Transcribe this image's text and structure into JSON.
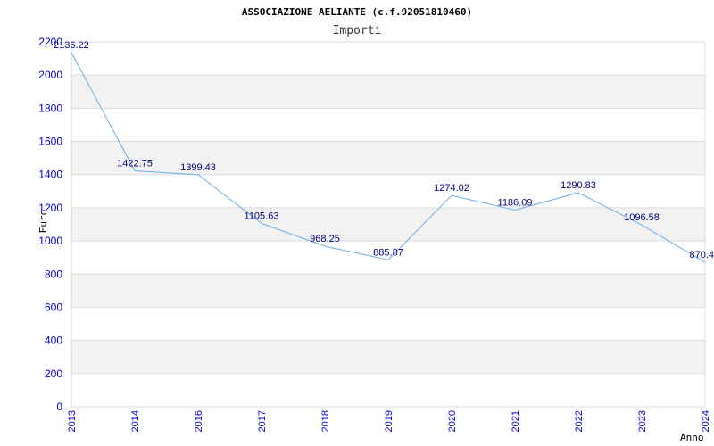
{
  "chart_data": {
    "type": "line",
    "title": "ASSOCIAZIONE AELIANTE (c.f.92051810460)",
    "subtitle": "Importi",
    "xlabel": "Anno",
    "ylabel": "Euro",
    "categories": [
      "2013",
      "2014",
      "2016",
      "2017",
      "2018",
      "2019",
      "2020",
      "2021",
      "2022",
      "2023",
      "2024"
    ],
    "values": [
      2136.22,
      1422.75,
      1399.43,
      1105.63,
      968.25,
      885.87,
      1274.02,
      1186.09,
      1290.83,
      1096.58,
      870.4
    ],
    "data_labels": [
      "2136.22",
      "1422.75",
      "1399.43",
      "1105.63",
      "968.25",
      "885.87",
      "1274.02",
      "1186.09",
      "1290.83",
      "1096.58",
      "870.4"
    ],
    "ylim": [
      0,
      2200
    ],
    "yticks": [
      0,
      200,
      400,
      600,
      800,
      1000,
      1200,
      1400,
      1600,
      1800,
      2000,
      2200
    ],
    "grid": true,
    "legend": "none",
    "colors": {
      "line": "#6aaee8",
      "band": "#f2f2f2",
      "gridline": "#dddddd",
      "tick_text": "#0000cc",
      "data_label": "#000080"
    }
  }
}
